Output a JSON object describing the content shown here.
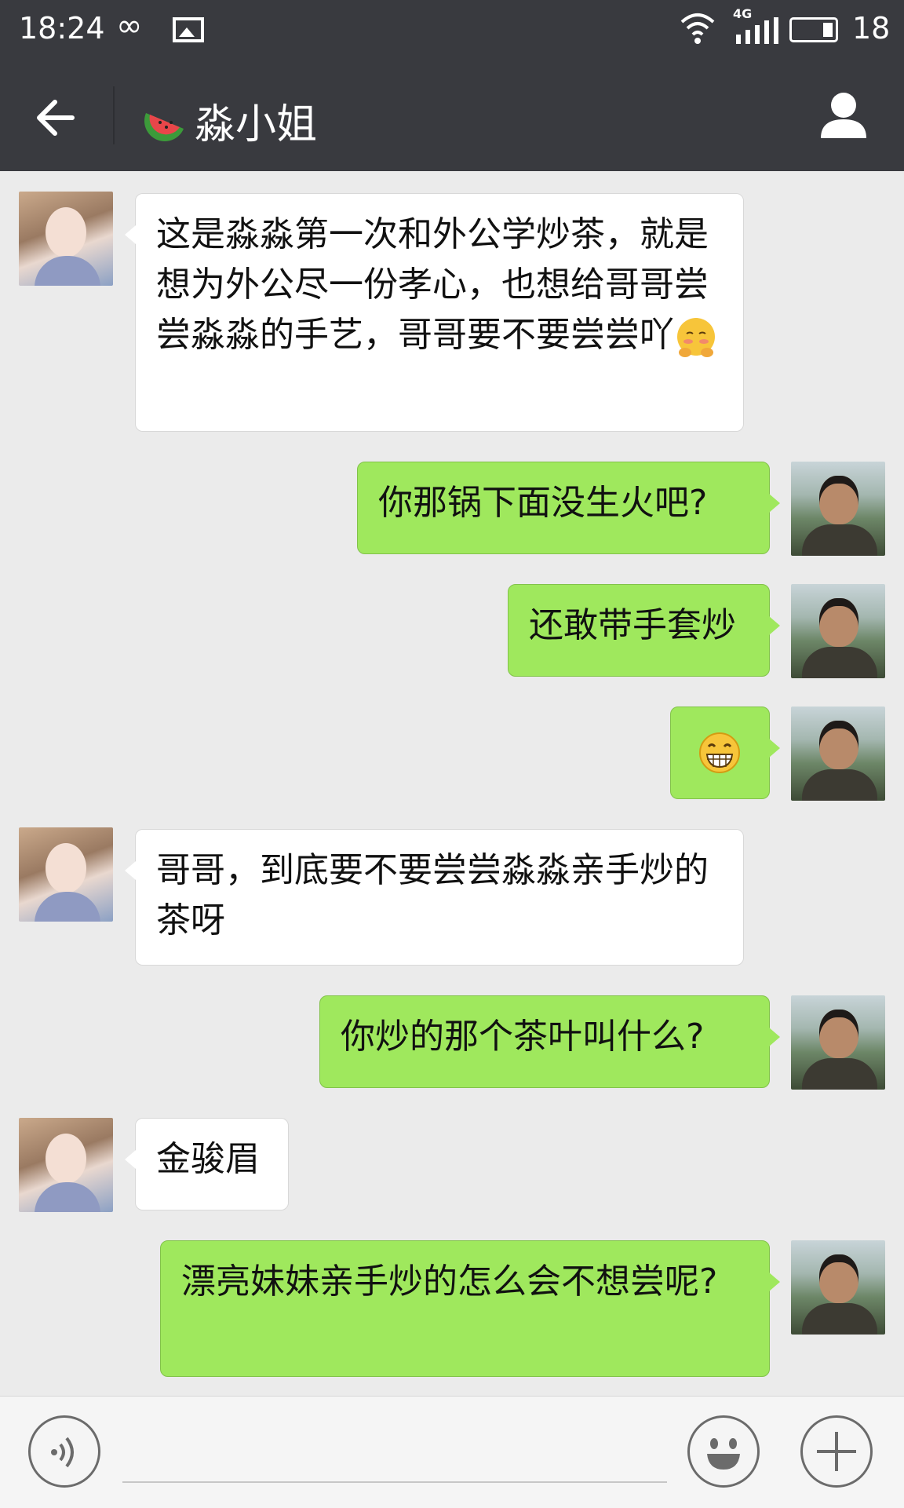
{
  "status_bar": {
    "time": "18:24",
    "loop_icon": "∞",
    "network": "4G",
    "battery": "18",
    "icons": [
      "infinity-icon",
      "image-icon",
      "wifi-icon",
      "signal-icon",
      "battery-icon"
    ]
  },
  "header": {
    "title": "淼小姐",
    "back_icon": "arrow-left-icon",
    "title_emoji": "watermelon-icon",
    "profile_icon": "person-icon",
    "background": "#393a3f"
  },
  "messages": [
    {
      "sender": "her",
      "text": "这是淼淼第一次和外公学炒茶，就是想为外公尽一份孝心，也想给哥哥尝尝淼淼的手艺，哥哥要不要尝尝吖",
      "emoji": "shy-face-emoji"
    },
    {
      "sender": "me",
      "text": "你那锅下面没生火吧?"
    },
    {
      "sender": "me",
      "text": "还敢带手套炒"
    },
    {
      "sender": "me",
      "text": "",
      "emoji": "grin-emoji"
    },
    {
      "sender": "her",
      "text": "哥哥，到底要不要尝尝淼淼亲手炒的茶呀"
    },
    {
      "sender": "me",
      "text": "你炒的那个茶叶叫什么?"
    },
    {
      "sender": "her",
      "text": "金骏眉"
    },
    {
      "sender": "me",
      "text": "漂亮妹妹亲手炒的怎么会不想尝呢?"
    }
  ],
  "colors": {
    "my_bubble": "#9fe85d",
    "her_bubble": "#ffffff",
    "chat_background": "#ebebeb"
  },
  "input_bar": {
    "voice_icon": "voice-icon",
    "emoji_icon": "smiley-icon",
    "plus_icon": "plus-icon"
  }
}
